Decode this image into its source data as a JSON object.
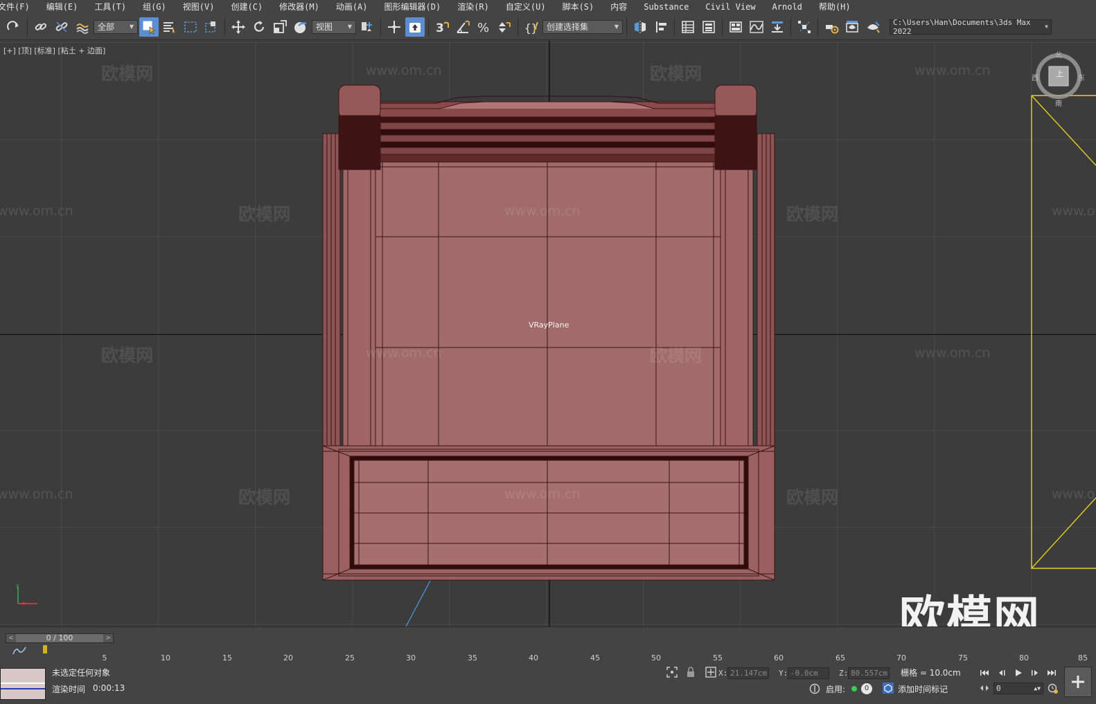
{
  "menu": {
    "items": [
      "文件(F)",
      "编辑(E)",
      "工具(T)",
      "组(G)",
      "视图(V)",
      "创建(C)",
      "修改器(M)",
      "动画(A)",
      "图形编辑器(D)",
      "渲染(R)",
      "自定义(U)",
      "脚本(S)",
      "内容",
      "Substance",
      "Civil View",
      "Arnold",
      "帮助(H)"
    ]
  },
  "toolbar": {
    "selection_filter": "全部",
    "reference_coord": "视图",
    "named_selection_set": "创建选择集",
    "project_path": "C:\\Users\\Han\\Documents\\3ds Max 2022"
  },
  "viewport": {
    "label": "[+] [顶] [标准] [粘土 + 边面]",
    "object_label": "VRayPlane",
    "watermark_text": "欧模网",
    "watermark_url": "www.om.cn",
    "big_logo": "欧模网",
    "viewcube": {
      "top": "上",
      "north": "北",
      "south": "南",
      "east": "东",
      "west": "西"
    },
    "colors": {
      "background": "#3c3c3c",
      "grid": "#505050",
      "model_fill": "#9b5f60",
      "model_wire": "#3a1414",
      "selection_yellow": "#e8d21c"
    }
  },
  "timeline": {
    "frame_display": "0 / 100",
    "ticks": [
      "5",
      "10",
      "15",
      "20",
      "25",
      "30",
      "35",
      "40",
      "45",
      "50",
      "55",
      "60",
      "65",
      "70",
      "75",
      "80",
      "85"
    ]
  },
  "status": {
    "selection_text": "未选定任何对象",
    "render_time_label": "渲染时间",
    "render_time_value": "0:00:13",
    "x_label": "X:",
    "x_value": "21.147cm",
    "y_label": "Y:",
    "y_value": "-0.0cm",
    "z_label": "Z:",
    "z_value": "80.557cm",
    "grid_text": "栅格 = 10.0cm",
    "enable_label": "启用:",
    "enable_count": "0",
    "add_time_tag": "添加时间标记",
    "current_frame": "0"
  }
}
